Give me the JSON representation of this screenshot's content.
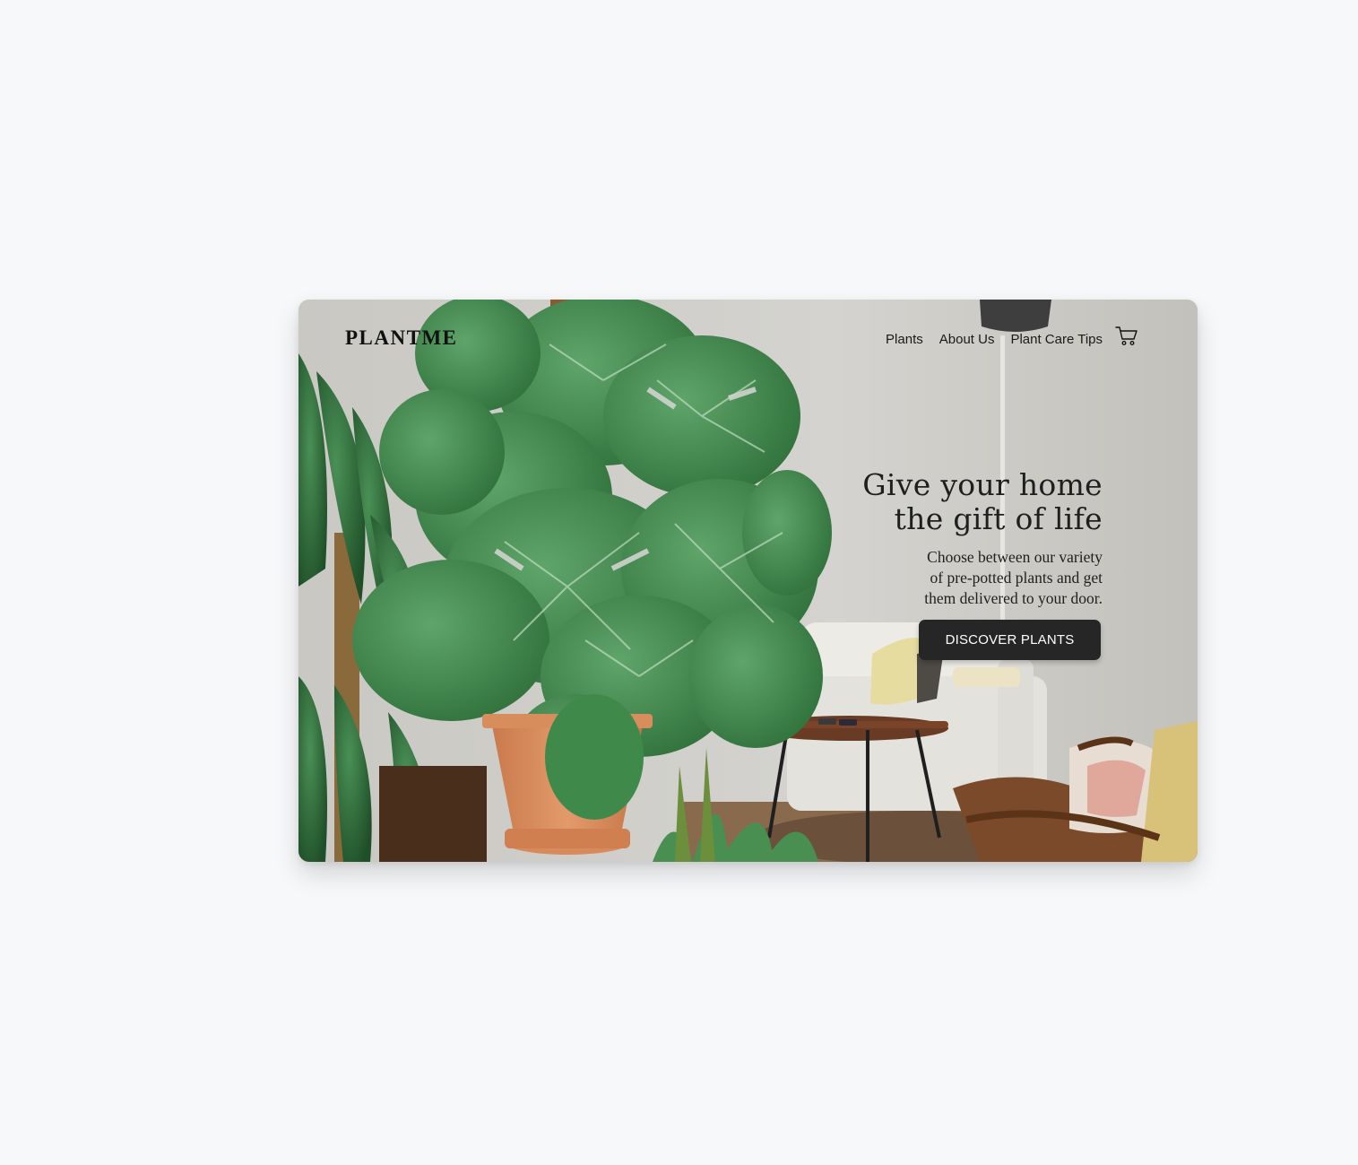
{
  "brand": {
    "logo_text": "PLANTME"
  },
  "nav": {
    "links": [
      {
        "label": "Plants"
      },
      {
        "label": "About Us"
      },
      {
        "label": "Plant Care Tips"
      }
    ],
    "cart_icon": "shopping-cart-icon"
  },
  "hero": {
    "headline_line1": "Give your home",
    "headline_line2": "the gift of life",
    "subtext_line1": "Choose between our variety",
    "subtext_line2": "of pre-potted plants and get",
    "subtext_line3": "them delivered to your door.",
    "cta_label": "DISCOVER PLANTS",
    "background_image": "photo of a monstera plant in a terracotta pot in a living room with a white sofa, side table and wooden armchair"
  },
  "colors": {
    "page_background": "#f7f8fa",
    "cta_background": "#262626",
    "cta_text": "#ffffff",
    "text_dark": "#1f1f1f",
    "leaf_green": "#3f8a4b",
    "pot_terracotta": "#d98a5c"
  }
}
